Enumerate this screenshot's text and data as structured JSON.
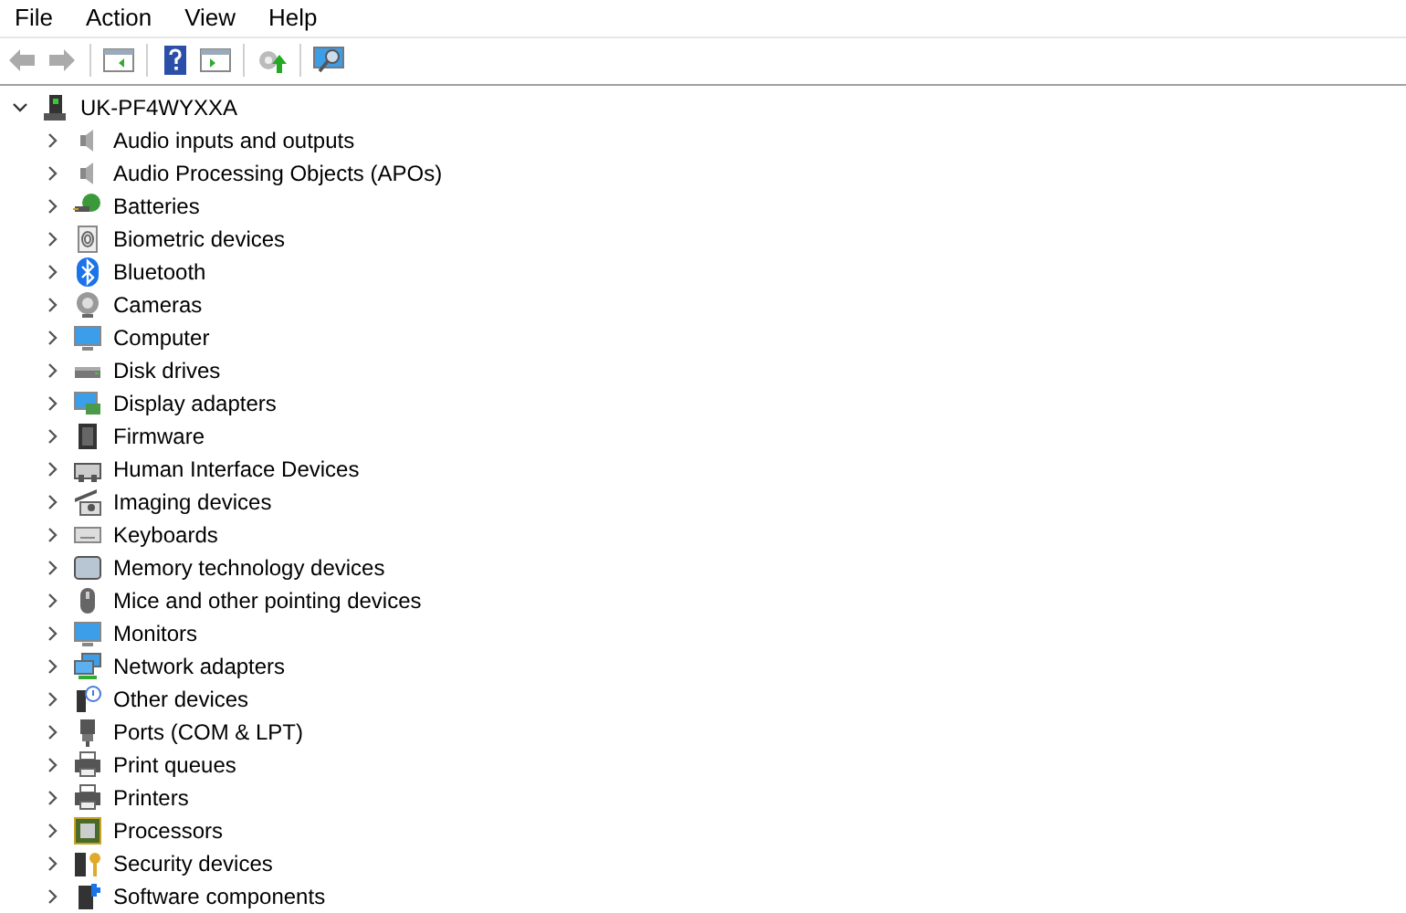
{
  "menu": [
    "File",
    "Action",
    "View",
    "Help"
  ],
  "tree": {
    "label": "UK-PF4WYXXA",
    "expanded": true,
    "children": [
      {
        "label": "Audio inputs and outputs",
        "expanded": false
      },
      {
        "label": "Audio Processing Objects (APOs)",
        "expanded": false
      },
      {
        "label": "Batteries",
        "expanded": false
      },
      {
        "label": "Biometric devices",
        "expanded": false
      },
      {
        "label": "Bluetooth",
        "expanded": false
      },
      {
        "label": "Cameras",
        "expanded": false
      },
      {
        "label": "Computer",
        "expanded": false
      },
      {
        "label": "Disk drives",
        "expanded": false
      },
      {
        "label": "Display adapters",
        "expanded": false
      },
      {
        "label": "Firmware",
        "expanded": false
      },
      {
        "label": "Human Interface Devices",
        "expanded": false
      },
      {
        "label": "Imaging devices",
        "expanded": false
      },
      {
        "label": "Keyboards",
        "expanded": false
      },
      {
        "label": "Memory technology devices",
        "expanded": false
      },
      {
        "label": "Mice and other pointing devices",
        "expanded": false
      },
      {
        "label": "Monitors",
        "expanded": false
      },
      {
        "label": "Network adapters",
        "expanded": false
      },
      {
        "label": "Other devices",
        "expanded": false
      },
      {
        "label": "Ports (COM & LPT)",
        "expanded": false
      },
      {
        "label": "Print queues",
        "expanded": false
      },
      {
        "label": "Printers",
        "expanded": false
      },
      {
        "label": "Processors",
        "expanded": false
      },
      {
        "label": "Security devices",
        "expanded": false
      },
      {
        "label": "Software components",
        "expanded": false
      }
    ]
  }
}
